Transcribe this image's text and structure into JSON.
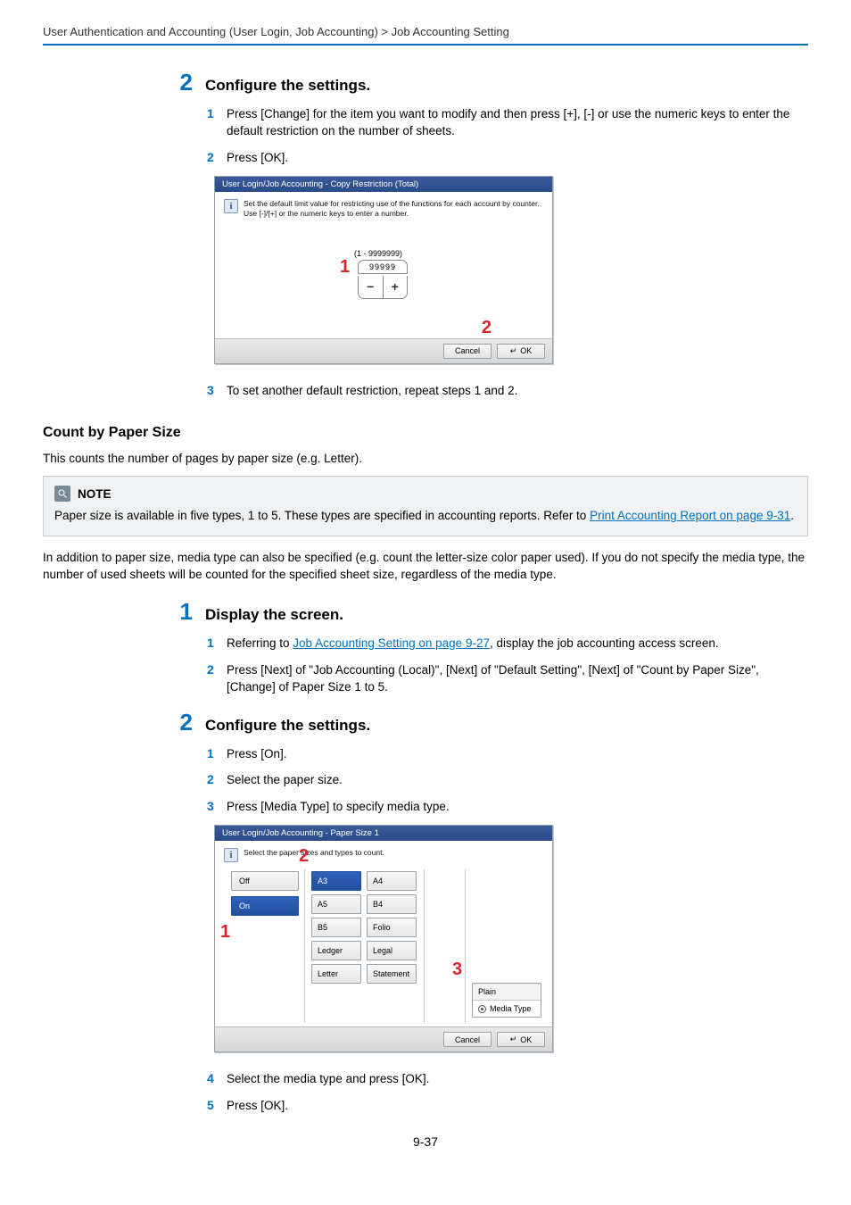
{
  "breadcrumb": "User Authentication and Accounting (User Login, Job Accounting) > Job Accounting Setting",
  "section1": {
    "num": "2",
    "heading": "Configure the settings.",
    "s1": {
      "n": "1",
      "t": "Press [Change] for the item you want to modify and then press [+], [-] or use the numeric keys to enter the default restriction on the number of sheets."
    },
    "s2": {
      "n": "2",
      "t": "Press [OK]."
    },
    "s3": {
      "n": "3",
      "t": "To set another default restriction, repeat steps 1 and 2."
    }
  },
  "panel1": {
    "title": "User Login/Job Accounting - Copy Restriction (Total)",
    "msg1": "Set the default limit value for restricting use of the functions for each account by counter.",
    "msg2": "Use [-]/[+] or the numeric keys to enter a number.",
    "range": "(1 - 9999999)",
    "value": "99999",
    "minus": "−",
    "plus": "+",
    "callout1": "1",
    "callout2": "2",
    "cancel": "Cancel",
    "ok": "OK"
  },
  "paperSize": {
    "title": "Count by Paper Size",
    "para1": "This counts the number of pages by paper size (e.g. Letter).",
    "note_label": "NOTE",
    "note_pre": "Paper size is available in five types, 1 to 5. These types are specified in accounting reports. Refer to ",
    "note_link": "Print Accounting Report on page 9-31",
    "note_post": ".",
    "para2": "In addition to paper size, media type can also be specified (e.g. count the letter-size color paper used). If you do not specify the media type, the number of used sheets will be counted for the specified sheet size, regardless of the media type."
  },
  "section2": {
    "num": "1",
    "heading": "Display the screen.",
    "s1": {
      "n": "1",
      "pre": "Referring to ",
      "link": "Job Accounting Setting on page 9-27",
      "post": ", display the job accounting access screen."
    },
    "s2": {
      "n": "2",
      "t": "Press [Next] of \"Job Accounting (Local)\", [Next] of \"Default Setting\", [Next] of \"Count by Paper Size\", [Change] of Paper Size 1 to 5."
    }
  },
  "section3": {
    "num": "2",
    "heading": "Configure the settings.",
    "s1": {
      "n": "1",
      "t": "Press [On]."
    },
    "s2": {
      "n": "2",
      "t": "Select the paper size."
    },
    "s3": {
      "n": "3",
      "t": "Press [Media Type] to specify media type."
    },
    "s4": {
      "n": "4",
      "t": "Select the media type and press [OK]."
    },
    "s5": {
      "n": "5",
      "t": "Press [OK]."
    }
  },
  "panel2": {
    "title": "User Login/Job Accounting - Paper Size 1",
    "msg": "Select the paper sizes and types to count.",
    "off": "Off",
    "on": "On",
    "col1": [
      "A3",
      "A5",
      "B5",
      "Ledger",
      "Letter"
    ],
    "col2": [
      "A4",
      "B4",
      "Folio",
      "Legal",
      "Statement"
    ],
    "mt_top": "Plain",
    "mt_bot": "Media Type",
    "callout1": "1",
    "callout2": "2",
    "callout3": "3",
    "cancel": "Cancel",
    "ok": "OK"
  },
  "pagenum": "9-37"
}
